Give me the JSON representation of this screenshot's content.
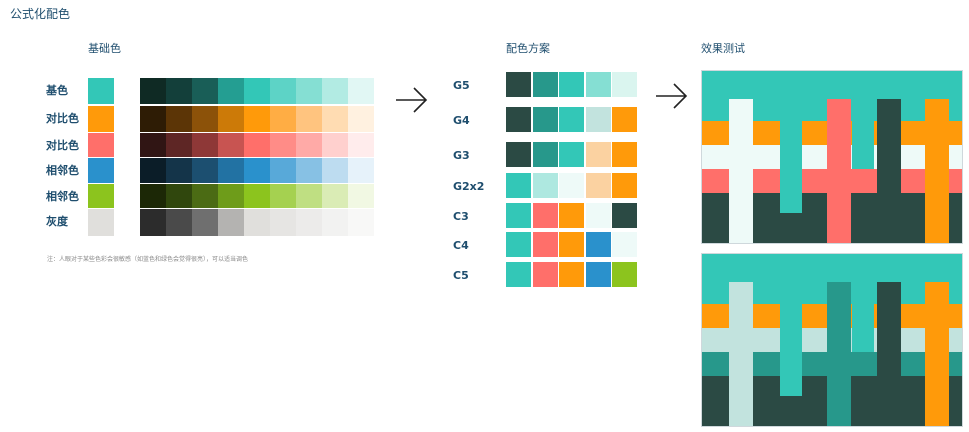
{
  "page_title": "公式化配色",
  "sections": {
    "base_title": "基础色",
    "scheme_title": "配色方案",
    "test_title": "效果测试"
  },
  "note": "注：人眼对于某些色彩会很敏感（如蓝色和绿色会觉得很亮），可以适当调色",
  "base_rows": [
    {
      "label": "基色",
      "swatch": "#33c7b7",
      "shades": [
        "#0f2a24",
        "#133f3a",
        "#195e57",
        "#249e92",
        "#33c7b7",
        "#5dd3c6",
        "#85dfd3",
        "#b2ebe3",
        "#e1f7f4"
      ]
    },
    {
      "label": "对比色",
      "swatch": "#ff9a0a",
      "shades": [
        "#2e1c05",
        "#5c3506",
        "#8c5209",
        "#cc7a08",
        "#ff9a0a",
        "#ffad44",
        "#ffc47f",
        "#ffdcb2",
        "#fff1e0"
      ]
    },
    {
      "label": "对比色",
      "swatch": "#ff6f6a",
      "shades": [
        "#301514",
        "#5e2625",
        "#8e3837",
        "#c85451",
        "#ff6f6a",
        "#ff8c87",
        "#ffaaa7",
        "#ffd0ce",
        "#ffecec"
      ]
    },
    {
      "label": "相邻色",
      "swatch": "#2a91cc",
      "shades": [
        "#0b1d28",
        "#143449",
        "#1c4f70",
        "#2272a3",
        "#2a91cc",
        "#58a9d9",
        "#87c1e4",
        "#bddcf0",
        "#e6f2fa"
      ]
    },
    {
      "label": "相邻色",
      "swatch": "#8cc41e",
      "shades": [
        "#1c2806",
        "#30470d",
        "#4b6b14",
        "#6e9c1a",
        "#8cc41e",
        "#a5d150",
        "#bfdf82",
        "#daecb5",
        "#f1f8e3"
      ]
    },
    {
      "label": "灰度",
      "swatch": "#e0dfdc",
      "shades": [
        "#2c2c2c",
        "#4a4a4a",
        "#6f6f6f",
        "#b4b3b1",
        "#e0dfdc",
        "#e6e5e3",
        "#ecebea",
        "#f2f2f1",
        "#f8f8f7"
      ]
    }
  ],
  "schemes": [
    {
      "label": "G5",
      "colors": [
        "#2b4a44",
        "#27988b",
        "#33c7b7",
        "#85dfd3",
        "#daf5ef"
      ]
    },
    {
      "label": "G4",
      "colors": [
        "#2b4a44",
        "#27988b",
        "#33c7b7",
        "#c2e3de",
        "#ff9a0a"
      ]
    },
    {
      "label": "G3",
      "colors": [
        "#2b4a44",
        "#27988b",
        "#33c7b7",
        "#fbd2a1",
        "#ff9a0a"
      ]
    },
    {
      "label": "G2x2",
      "colors": [
        "#33c7b7",
        "#aee8e0",
        "#eefaf8",
        "#fbd2a1",
        "#ff9a0a"
      ]
    },
    {
      "label": "C3",
      "colors": [
        "#33c7b7",
        "#ff6f6a",
        "#ff9a0a",
        "#eefaf8",
        "#2b4a44"
      ]
    },
    {
      "label": "C4",
      "colors": [
        "#33c7b7",
        "#ff6f6a",
        "#ff9a0a",
        "#2a91cc",
        "#eefaf8"
      ]
    },
    {
      "label": "C5",
      "colors": [
        "#33c7b7",
        "#ff6f6a",
        "#ff9a0a",
        "#2a91cc",
        "#8cc41e"
      ]
    }
  ],
  "previews": [
    {
      "teal": "#33c7b7",
      "orange": "#ff9a0a",
      "light": "#eefaf8",
      "red": "#ff6f6a",
      "dark": "#2b4a44",
      "cross1": "#eefaf8",
      "cross2": "#ff6f6a",
      "cross3": "#ff9a0a",
      "pillar": "#33c7b7"
    },
    {
      "teal": "#33c7b7",
      "orange": "#ff9a0a",
      "light": "#c2e3de",
      "red": "#27988b",
      "dark": "#2b4a44",
      "cross1": "#c2e3de",
      "cross2": "#27988b",
      "cross3": "#ff9a0a",
      "pillar": "#33c7b7"
    }
  ]
}
